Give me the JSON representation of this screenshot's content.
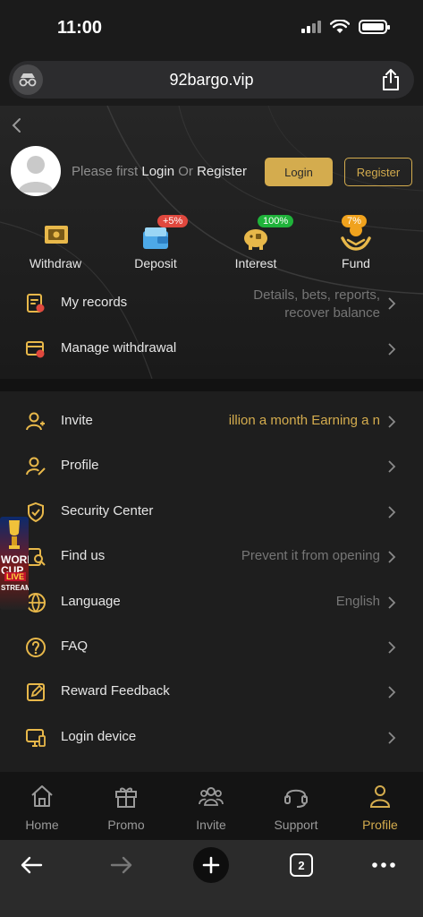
{
  "status": {
    "time": "11:00"
  },
  "browser": {
    "url": "92bargo.vip",
    "tab_count": "2"
  },
  "header": {
    "prompt_prefix": "Please first ",
    "prompt_login": "Login",
    "prompt_or": " Or ",
    "prompt_register": "Register",
    "login_button": "Login",
    "register_button": "Register"
  },
  "quick_actions": [
    {
      "label": "Withdraw",
      "badge": "",
      "icon": "ticket-icon"
    },
    {
      "label": "Deposit",
      "badge": "+5%",
      "badge_color": "#e0483e",
      "icon": "wallet-icon"
    },
    {
      "label": "Interest",
      "badge": "100%",
      "badge_color": "#1fb33a",
      "icon": "piggy-bank-icon"
    },
    {
      "label": "Fund",
      "badge": "7%",
      "badge_color": "#f0a21d",
      "icon": "hand-coin-icon"
    }
  ],
  "account_rows": [
    {
      "label": "My records",
      "value_line1": "Details, bets, reports,",
      "value_line2": "recover balance",
      "icon": "records-icon"
    },
    {
      "label": "Manage withdrawal",
      "icon": "card-gear-icon"
    }
  ],
  "menu": [
    {
      "label": "Invite",
      "value": "illion a month  Earning a n",
      "icon": "invite-user-icon"
    },
    {
      "label": "Profile",
      "value": "",
      "icon": "profile-edit-icon"
    },
    {
      "label": "Security Center",
      "value": "",
      "icon": "shield-check-icon"
    },
    {
      "label": "Find us",
      "value": "Prevent it from opening",
      "icon": "find-us-icon"
    },
    {
      "label": "Language",
      "value": "English",
      "icon": "globe-icon"
    },
    {
      "label": "FAQ",
      "value": "",
      "icon": "question-icon"
    },
    {
      "label": "Reward Feedback",
      "value": "",
      "icon": "edit-box-icon"
    },
    {
      "label": "Login device",
      "value": "",
      "icon": "device-icon"
    }
  ],
  "promo": {
    "line1": "WORLD CUP",
    "line2": "LIVE",
    "line3": "STREAM"
  },
  "bottom_nav": [
    {
      "label": "Home",
      "icon": "home-icon"
    },
    {
      "label": "Promo",
      "icon": "gift-icon"
    },
    {
      "label": "Invite",
      "icon": "group-icon"
    },
    {
      "label": "Support",
      "icon": "headset-icon"
    },
    {
      "label": "Profile",
      "icon": "person-icon",
      "active": true
    }
  ],
  "colors": {
    "accent": "#d4ac4e",
    "background": "#1b1b1b"
  }
}
